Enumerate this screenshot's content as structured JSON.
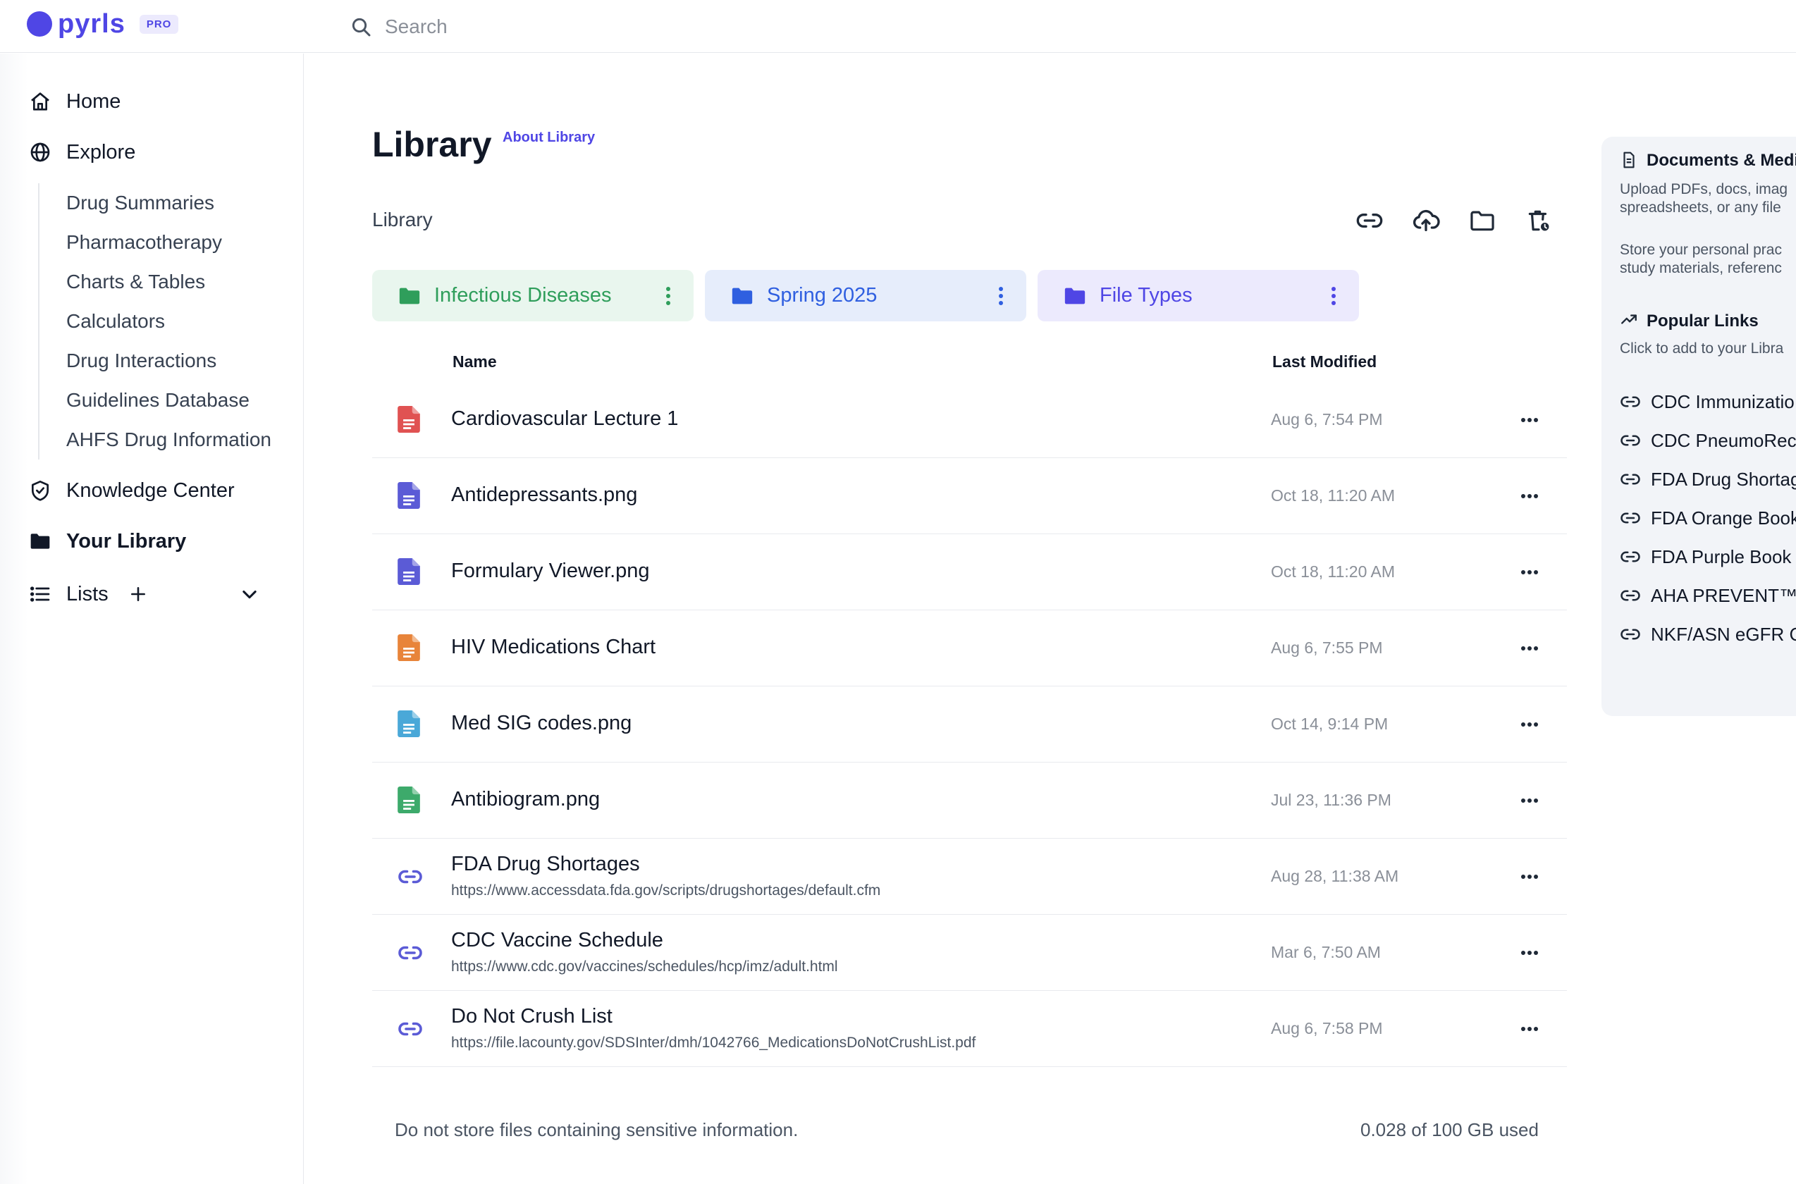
{
  "brand": {
    "name": "pyrls",
    "badge": "PRO"
  },
  "search": {
    "placeholder": "Search"
  },
  "sidebar": {
    "items": [
      {
        "label": "Home",
        "icon": "home-icon"
      },
      {
        "label": "Explore",
        "icon": "globe-icon"
      },
      {
        "label": "Knowledge Center",
        "icon": "shield-check-icon"
      },
      {
        "label": "Your Library",
        "icon": "folder-icon"
      },
      {
        "label": "Lists",
        "icon": "list-icon"
      }
    ],
    "explore_subitems": [
      "Drug Summaries",
      "Pharmacotherapy",
      "Charts & Tables",
      "Calculators",
      "Drug Interactions",
      "Guidelines Database",
      "AHFS Drug Information"
    ]
  },
  "page": {
    "title": "Library",
    "about_link": "About Library",
    "breadcrumb": "Library"
  },
  "toolbar": {
    "icons": [
      "link-icon",
      "cloud-upload-icon",
      "folder-icon",
      "trash-clock-icon"
    ]
  },
  "folders": [
    {
      "name": "Infectious Diseases",
      "color": "#2f9e5b",
      "bg": "#e9f6ee"
    },
    {
      "name": "Spring 2025",
      "color": "#2f5fe0",
      "bg": "#e6edfb"
    },
    {
      "name": "File Types",
      "color": "#4f46e5",
      "bg": "#eceafd"
    }
  ],
  "table": {
    "columns": {
      "name": "Name",
      "modified": "Last Modified"
    },
    "rows": [
      {
        "name": "Cardiovascular Lecture 1",
        "url": "",
        "modified": "Aug 6, 7:54 PM",
        "type": "file",
        "color": "#e05252"
      },
      {
        "name": "Antidepressants.png",
        "url": "",
        "modified": "Oct 18, 11:20 AM",
        "type": "file",
        "color": "#5b5bd6"
      },
      {
        "name": "Formulary Viewer.png",
        "url": "",
        "modified": "Oct 18, 11:20 AM",
        "type": "file",
        "color": "#5b5bd6"
      },
      {
        "name": "HIV Medications Chart",
        "url": "",
        "modified": "Aug 6, 7:55 PM",
        "type": "file",
        "color": "#e8843a"
      },
      {
        "name": "Med SIG codes.png",
        "url": "",
        "modified": "Oct 14, 9:14 PM",
        "type": "file",
        "color": "#4aa8d8"
      },
      {
        "name": "Antibiogram.png",
        "url": "",
        "modified": "Jul 23, 11:36 PM",
        "type": "file",
        "color": "#3daa6b"
      },
      {
        "name": "FDA Drug Shortages",
        "url": "https://www.accessdata.fda.gov/scripts/drugshortages/default.cfm",
        "modified": "Aug 28, 11:38 AM",
        "type": "link",
        "color": "#5b5bd6"
      },
      {
        "name": "CDC Vaccine Schedule",
        "url": "https://www.cdc.gov/vaccines/schedules/hcp/imz/adult.html",
        "modified": "Mar 6, 7:50 AM",
        "type": "link",
        "color": "#5b5bd6"
      },
      {
        "name": "Do Not Crush List",
        "url": "https://file.lacounty.gov/SDSInter/dmh/1042766_MedicationsDoNotCrushList.pdf",
        "modified": "Aug 6, 7:58 PM",
        "type": "link",
        "color": "#5b5bd6"
      }
    ]
  },
  "footer": {
    "note": "Do not store files containing sensitive information.",
    "storage": "0.028 of 100 GB used"
  },
  "right_panel": {
    "docs_title": "Documents & Medi",
    "docs_text_1": "Upload PDFs, docs, imag",
    "docs_text_2": "spreadsheets, or any file",
    "docs_text_3": "Store your personal prac",
    "docs_text_4": "study materials, referenc",
    "popular_title": "Popular Links",
    "popular_sub": "Click to add to your Libra",
    "links": [
      "CDC Immunizatio",
      "CDC PneumoRec",
      "FDA Drug Shortag",
      "FDA Orange Book",
      "FDA Purple Book",
      "AHA PREVENT™ C",
      "NKF/ASN eGFR C"
    ]
  }
}
